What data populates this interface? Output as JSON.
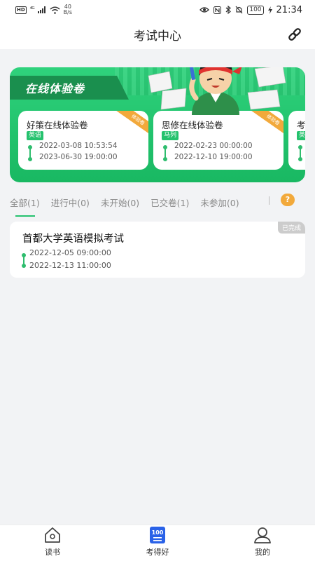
{
  "status_bar": {
    "hd": "HD",
    "signal": "⁴ᴳ",
    "speed_value": "40",
    "speed_unit": "B/s",
    "battery": "100",
    "time": "21:34"
  },
  "header": {
    "title": "考试中心"
  },
  "banner": {
    "title": "在线体验卷",
    "cards": [
      {
        "title": "好策在线体验卷",
        "tag": "英语",
        "ribbon": "体验卷",
        "start": "2022-03-08 10:53:54",
        "end": "2023-06-30 19:00:00"
      },
      {
        "title": "思修在线体验卷",
        "tag": "马列",
        "ribbon": "体验卷",
        "start": "2022-02-23 00:00:00",
        "end": "2022-12-10 19:00:00"
      },
      {
        "title": "考",
        "tag": "英语",
        "ribbon": "",
        "start": "",
        "end": ""
      }
    ]
  },
  "tabs": [
    {
      "label": "全部(1)"
    },
    {
      "label": "进行中(0)"
    },
    {
      "label": "未开始(0)"
    },
    {
      "label": "已交卷(1)"
    },
    {
      "label": "未参加(0)"
    }
  ],
  "help_badge": "?",
  "exams": [
    {
      "title": "首都大学英语模拟考试",
      "status": "已完成",
      "start": "2022-12-05 09:00:00",
      "end": "2022-12-13 11:00:00"
    }
  ],
  "bottom_nav": [
    {
      "label": "读书",
      "icon": "home-icon"
    },
    {
      "label": "考得好",
      "icon": "score-100-icon"
    },
    {
      "label": "我的",
      "icon": "user-icon"
    }
  ],
  "colors": {
    "accent": "#25c26e",
    "ribbon": "#f2a93b",
    "nav_active": "#2a62e8"
  }
}
